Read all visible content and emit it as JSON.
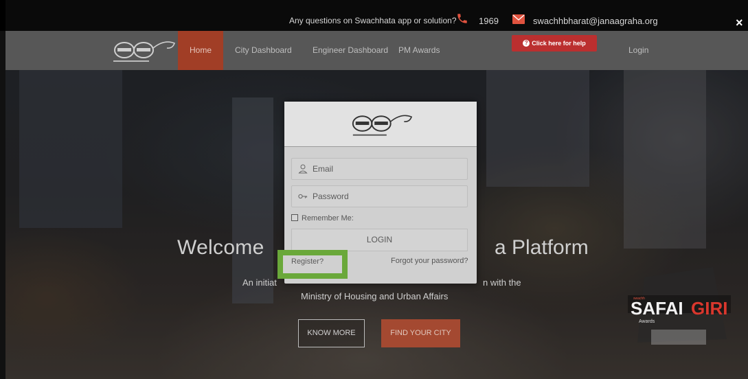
{
  "topbar": {
    "question": "Any questions on Swachhata app or solution?",
    "phone_icon": "phone-icon",
    "phone": "1969",
    "mail_icon": "mail-icon",
    "email": "swachhbharat@janaagraha.org",
    "close_label": "×"
  },
  "nav": {
    "logo": "swachh-bharat-logo",
    "items": [
      "Home",
      "City Dashboard",
      "Engineer Dashboard",
      "PM Awards"
    ],
    "active": "Home",
    "help_button": "Click here for help",
    "login": "Login"
  },
  "hero": {
    "welcome": "Welcome",
    "platform": "a Platform",
    "initiative_left": "An initiat",
    "initiative_right": "n with the",
    "ministry": "Ministry of Housing and Urban Affairs",
    "know_more": "KNOW MORE",
    "find_city": "FIND YOUR CITY",
    "badge_safai": "SAFAI",
    "badge_giri": "GIRI",
    "badge_awards": "Awards"
  },
  "modal": {
    "email_placeholder": "Email",
    "password_placeholder": "Password",
    "remember": "Remember Me:",
    "login_button": "LOGIN",
    "register": "Register?",
    "forgot": "Forgot your password?"
  },
  "colors": {
    "nav_bg": "#575757",
    "active_nav": "#a13e26",
    "help_red": "#bb2f2f",
    "highlight_green": "#6aa83a",
    "find_city": "#a44931"
  }
}
